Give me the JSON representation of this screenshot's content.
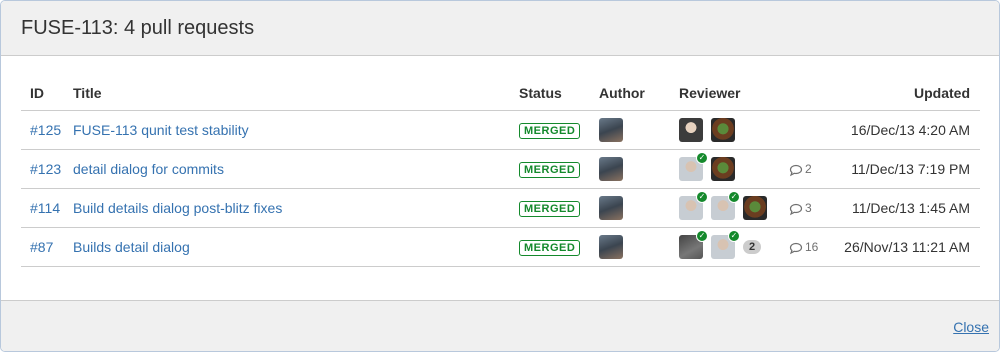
{
  "dialog": {
    "title": "FUSE-113: 4 pull requests",
    "close_label": "Close"
  },
  "table": {
    "headers": {
      "id": "ID",
      "title": "Title",
      "status": "Status",
      "author": "Author",
      "reviewer": "Reviewer",
      "updated": "Updated"
    },
    "rows": [
      {
        "id": "#125",
        "title": "FUSE-113 qunit test stability",
        "status": "MERGED",
        "comments": "",
        "updated": "16/Dec/13 4:20 AM"
      },
      {
        "id": "#123",
        "title": "detail dialog for commits",
        "status": "MERGED",
        "comments": "2",
        "updated": "11/Dec/13 7:19 PM"
      },
      {
        "id": "#114",
        "title": "Build details dialog post-blitz fixes",
        "status": "MERGED",
        "comments": "3",
        "updated": "11/Dec/13 1:45 AM"
      },
      {
        "id": "#87",
        "title": "Builds detail dialog",
        "status": "MERGED",
        "comments": "16",
        "more_reviewers": "2",
        "updated": "26/Nov/13 11:21 AM"
      }
    ]
  },
  "icons": {
    "approved": "check-icon",
    "comment": "comment-icon",
    "avatar": "avatar-icon"
  },
  "colors": {
    "link": "#3572b0",
    "merged": "#14892c",
    "header_bg": "#f0f0f0"
  }
}
